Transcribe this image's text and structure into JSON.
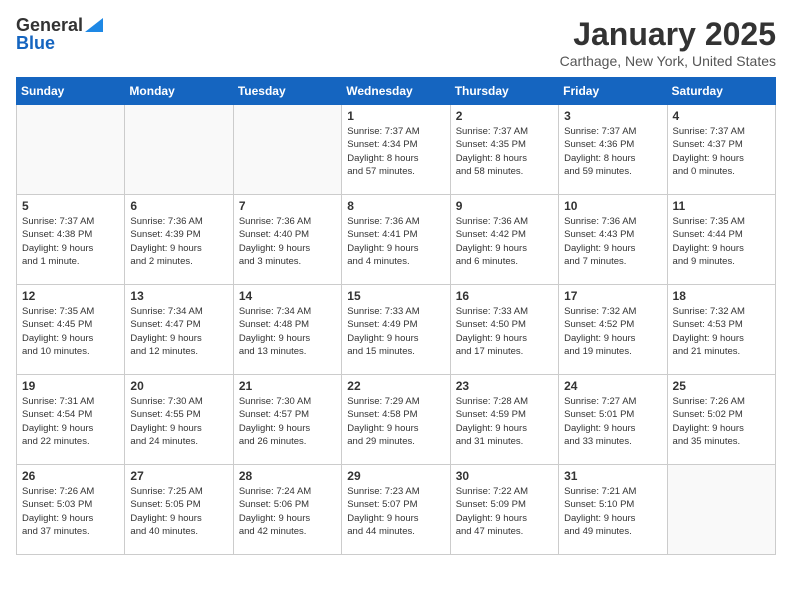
{
  "header": {
    "logo_line1": "General",
    "logo_line2": "Blue",
    "month": "January 2025",
    "location": "Carthage, New York, United States"
  },
  "days_of_week": [
    "Sunday",
    "Monday",
    "Tuesday",
    "Wednesday",
    "Thursday",
    "Friday",
    "Saturday"
  ],
  "weeks": [
    [
      {
        "day": "",
        "info": ""
      },
      {
        "day": "",
        "info": ""
      },
      {
        "day": "",
        "info": ""
      },
      {
        "day": "1",
        "info": "Sunrise: 7:37 AM\nSunset: 4:34 PM\nDaylight: 8 hours\nand 57 minutes."
      },
      {
        "day": "2",
        "info": "Sunrise: 7:37 AM\nSunset: 4:35 PM\nDaylight: 8 hours\nand 58 minutes."
      },
      {
        "day": "3",
        "info": "Sunrise: 7:37 AM\nSunset: 4:36 PM\nDaylight: 8 hours\nand 59 minutes."
      },
      {
        "day": "4",
        "info": "Sunrise: 7:37 AM\nSunset: 4:37 PM\nDaylight: 9 hours\nand 0 minutes."
      }
    ],
    [
      {
        "day": "5",
        "info": "Sunrise: 7:37 AM\nSunset: 4:38 PM\nDaylight: 9 hours\nand 1 minute."
      },
      {
        "day": "6",
        "info": "Sunrise: 7:36 AM\nSunset: 4:39 PM\nDaylight: 9 hours\nand 2 minutes."
      },
      {
        "day": "7",
        "info": "Sunrise: 7:36 AM\nSunset: 4:40 PM\nDaylight: 9 hours\nand 3 minutes."
      },
      {
        "day": "8",
        "info": "Sunrise: 7:36 AM\nSunset: 4:41 PM\nDaylight: 9 hours\nand 4 minutes."
      },
      {
        "day": "9",
        "info": "Sunrise: 7:36 AM\nSunset: 4:42 PM\nDaylight: 9 hours\nand 6 minutes."
      },
      {
        "day": "10",
        "info": "Sunrise: 7:36 AM\nSunset: 4:43 PM\nDaylight: 9 hours\nand 7 minutes."
      },
      {
        "day": "11",
        "info": "Sunrise: 7:35 AM\nSunset: 4:44 PM\nDaylight: 9 hours\nand 9 minutes."
      }
    ],
    [
      {
        "day": "12",
        "info": "Sunrise: 7:35 AM\nSunset: 4:45 PM\nDaylight: 9 hours\nand 10 minutes."
      },
      {
        "day": "13",
        "info": "Sunrise: 7:34 AM\nSunset: 4:47 PM\nDaylight: 9 hours\nand 12 minutes."
      },
      {
        "day": "14",
        "info": "Sunrise: 7:34 AM\nSunset: 4:48 PM\nDaylight: 9 hours\nand 13 minutes."
      },
      {
        "day": "15",
        "info": "Sunrise: 7:33 AM\nSunset: 4:49 PM\nDaylight: 9 hours\nand 15 minutes."
      },
      {
        "day": "16",
        "info": "Sunrise: 7:33 AM\nSunset: 4:50 PM\nDaylight: 9 hours\nand 17 minutes."
      },
      {
        "day": "17",
        "info": "Sunrise: 7:32 AM\nSunset: 4:52 PM\nDaylight: 9 hours\nand 19 minutes."
      },
      {
        "day": "18",
        "info": "Sunrise: 7:32 AM\nSunset: 4:53 PM\nDaylight: 9 hours\nand 21 minutes."
      }
    ],
    [
      {
        "day": "19",
        "info": "Sunrise: 7:31 AM\nSunset: 4:54 PM\nDaylight: 9 hours\nand 22 minutes."
      },
      {
        "day": "20",
        "info": "Sunrise: 7:30 AM\nSunset: 4:55 PM\nDaylight: 9 hours\nand 24 minutes."
      },
      {
        "day": "21",
        "info": "Sunrise: 7:30 AM\nSunset: 4:57 PM\nDaylight: 9 hours\nand 26 minutes."
      },
      {
        "day": "22",
        "info": "Sunrise: 7:29 AM\nSunset: 4:58 PM\nDaylight: 9 hours\nand 29 minutes."
      },
      {
        "day": "23",
        "info": "Sunrise: 7:28 AM\nSunset: 4:59 PM\nDaylight: 9 hours\nand 31 minutes."
      },
      {
        "day": "24",
        "info": "Sunrise: 7:27 AM\nSunset: 5:01 PM\nDaylight: 9 hours\nand 33 minutes."
      },
      {
        "day": "25",
        "info": "Sunrise: 7:26 AM\nSunset: 5:02 PM\nDaylight: 9 hours\nand 35 minutes."
      }
    ],
    [
      {
        "day": "26",
        "info": "Sunrise: 7:26 AM\nSunset: 5:03 PM\nDaylight: 9 hours\nand 37 minutes."
      },
      {
        "day": "27",
        "info": "Sunrise: 7:25 AM\nSunset: 5:05 PM\nDaylight: 9 hours\nand 40 minutes."
      },
      {
        "day": "28",
        "info": "Sunrise: 7:24 AM\nSunset: 5:06 PM\nDaylight: 9 hours\nand 42 minutes."
      },
      {
        "day": "29",
        "info": "Sunrise: 7:23 AM\nSunset: 5:07 PM\nDaylight: 9 hours\nand 44 minutes."
      },
      {
        "day": "30",
        "info": "Sunrise: 7:22 AM\nSunset: 5:09 PM\nDaylight: 9 hours\nand 47 minutes."
      },
      {
        "day": "31",
        "info": "Sunrise: 7:21 AM\nSunset: 5:10 PM\nDaylight: 9 hours\nand 49 minutes."
      },
      {
        "day": "",
        "info": ""
      }
    ]
  ]
}
